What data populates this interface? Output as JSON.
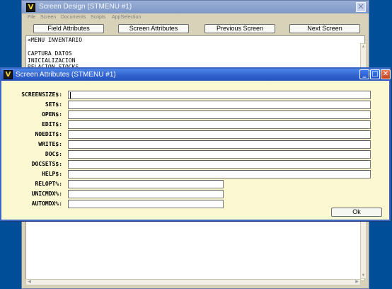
{
  "background_window": {
    "title": "Screen Design (STMENU #1)",
    "icon": "app-logo-icon",
    "close_glyph": "✕",
    "menu": [
      "File",
      "Screen",
      "Documents",
      "Scripts",
      "AppSelection"
    ],
    "buttons": [
      "Field Attributes",
      "Screen Attributes",
      "Previous Screen",
      "Next Screen"
    ],
    "listing_lines": [
      "<MENU INVENTARIO",
      "",
      "CAPTURA DATOS",
      "INICIALIZACION",
      "RELACION STOCKS"
    ]
  },
  "dialog": {
    "title": "Screen Attributes (STMENU #1)",
    "icon": "app-logo-icon",
    "controls": {
      "minimize": "_",
      "maximize": "□",
      "close": "✕"
    },
    "fields": [
      {
        "label": "SCREENSIZE$:",
        "value": ""
      },
      {
        "label": "SET$:",
        "value": ""
      },
      {
        "label": "OPEN$:",
        "value": ""
      },
      {
        "label": "EDIT$:",
        "value": ""
      },
      {
        "label": "NOEDIT$:",
        "value": ""
      },
      {
        "label": "WRITE$:",
        "value": ""
      },
      {
        "label": "DOC$:",
        "value": ""
      },
      {
        "label": "DOCSETS$:",
        "value": ""
      },
      {
        "label": "HELP$:",
        "value": ""
      },
      {
        "label": "RELOPT%:",
        "value": ""
      },
      {
        "label": "UNICMDX%:",
        "value": ""
      },
      {
        "label": "AUTOMDX%:",
        "value": ""
      }
    ],
    "ok_label": "Ok"
  },
  "colors": {
    "desktop": "#004e98",
    "dialog_title": "#2f60cc",
    "dialog_body": "#fbf8d2",
    "window_body": "#d8d2b8"
  }
}
